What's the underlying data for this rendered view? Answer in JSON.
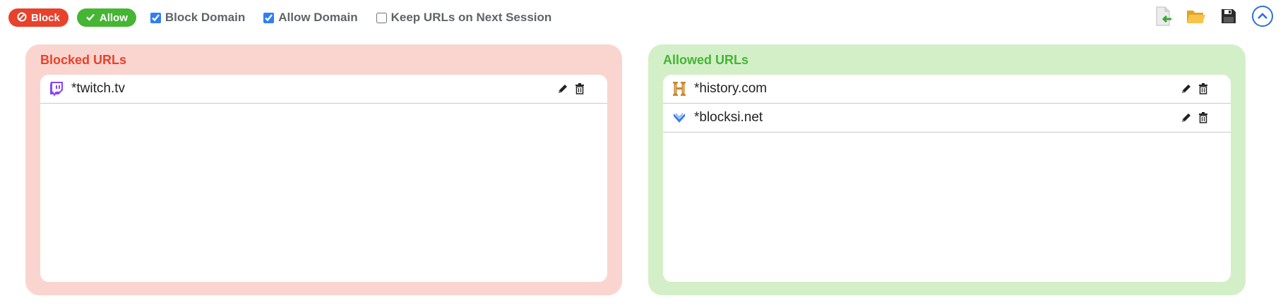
{
  "toolbar": {
    "block_label": "Block",
    "allow_label": "Allow",
    "block_icon": "ban-icon",
    "allow_icon": "check-icon",
    "checkboxes": [
      {
        "label": "Block Domain",
        "checked": true
      },
      {
        "label": "Allow Domain",
        "checked": true
      },
      {
        "label": "Keep URLs on Next Session",
        "checked": false
      }
    ],
    "tools": [
      "import-file-icon",
      "open-folder-icon",
      "save-icon",
      "collapse-up-icon"
    ]
  },
  "blocked": {
    "title": "Blocked URLs",
    "items": [
      {
        "url": "*twitch.tv",
        "icon": "twitch-icon"
      }
    ]
  },
  "allowed": {
    "title": "Allowed URLs",
    "items": [
      {
        "url": "*history.com",
        "icon": "history-h-icon"
      },
      {
        "url": "*blocksi.net",
        "icon": "blocksi-icon"
      }
    ]
  },
  "colors": {
    "block": "#e8412c",
    "allow": "#45b533",
    "blocked_panel": "#fad5cf",
    "allowed_panel": "#d3efc8",
    "accent": "#2f7ef6"
  }
}
